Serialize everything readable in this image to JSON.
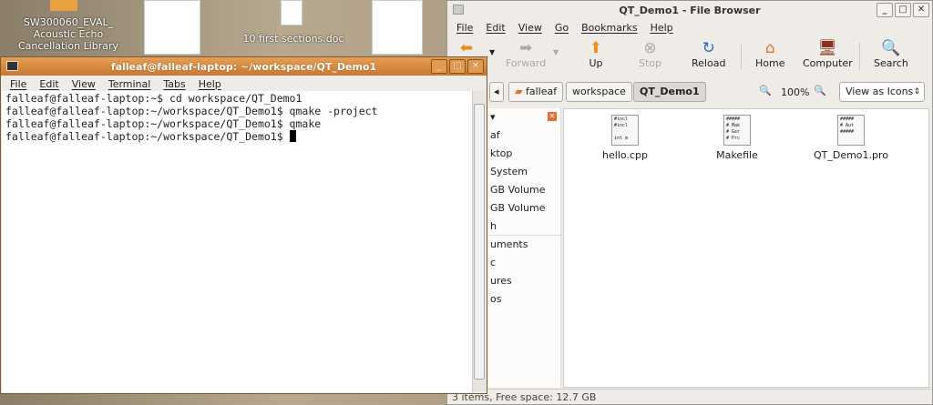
{
  "desktop": {
    "icons": [
      {
        "label": "SW300060_EVAL_ Acoustic Echo Cancellation Library"
      },
      {
        "label": "10 first sections.doc"
      }
    ]
  },
  "file_browser": {
    "title": "QT_Demo1 - File Browser",
    "menu": [
      "File",
      "Edit",
      "View",
      "Go",
      "Bookmarks",
      "Help"
    ],
    "toolbar": [
      {
        "label": "Back",
        "icon": "arrow-left-icon",
        "enabled": true
      },
      {
        "label": "Forward",
        "icon": "arrow-right-icon",
        "enabled": false
      },
      {
        "label": "Up",
        "icon": "arrow-up-icon",
        "enabled": true
      },
      {
        "label": "Stop",
        "icon": "stop-icon",
        "enabled": false
      },
      {
        "label": "Reload",
        "icon": "reload-icon",
        "enabled": true
      },
      {
        "label": "Home",
        "icon": "home-icon",
        "enabled": true
      },
      {
        "label": "Computer",
        "icon": "computer-icon",
        "enabled": true
      },
      {
        "label": "Search",
        "icon": "search-icon",
        "enabled": true
      }
    ],
    "breadcrumbs": [
      "falleaf",
      "workspace",
      "QT_Demo1"
    ],
    "zoom": "100%",
    "view_mode": "View as Icons",
    "sidebar": [
      "af",
      "ktop",
      "System",
      "GB Volume",
      "GB Volume",
      "h",
      "uments",
      "c",
      "ures",
      "os"
    ],
    "files": [
      {
        "name": "hello.cpp",
        "preview": "#incl\n#incl\n\nint m"
      },
      {
        "name": "Makefile",
        "preview": "#####\n# Mak\n# Ger\n# Prc"
      },
      {
        "name": "QT_Demo1.pro",
        "preview": "#####\n# Aut\n#####"
      }
    ],
    "status": "3 items, Free space: 12.7 GB"
  },
  "terminal": {
    "title": "falleaf@falleaf-laptop: ~/workspace/QT_Demo1",
    "menu": [
      "File",
      "Edit",
      "View",
      "Terminal",
      "Tabs",
      "Help"
    ],
    "lines": [
      "falleaf@falleaf-laptop:~$ cd workspace/QT_Demo1",
      "falleaf@falleaf-laptop:~/workspace/QT_Demo1$ qmake -project",
      "falleaf@falleaf-laptop:~/workspace/QT_Demo1$ qmake",
      "falleaf@falleaf-laptop:~/workspace/QT_Demo1$ "
    ]
  }
}
